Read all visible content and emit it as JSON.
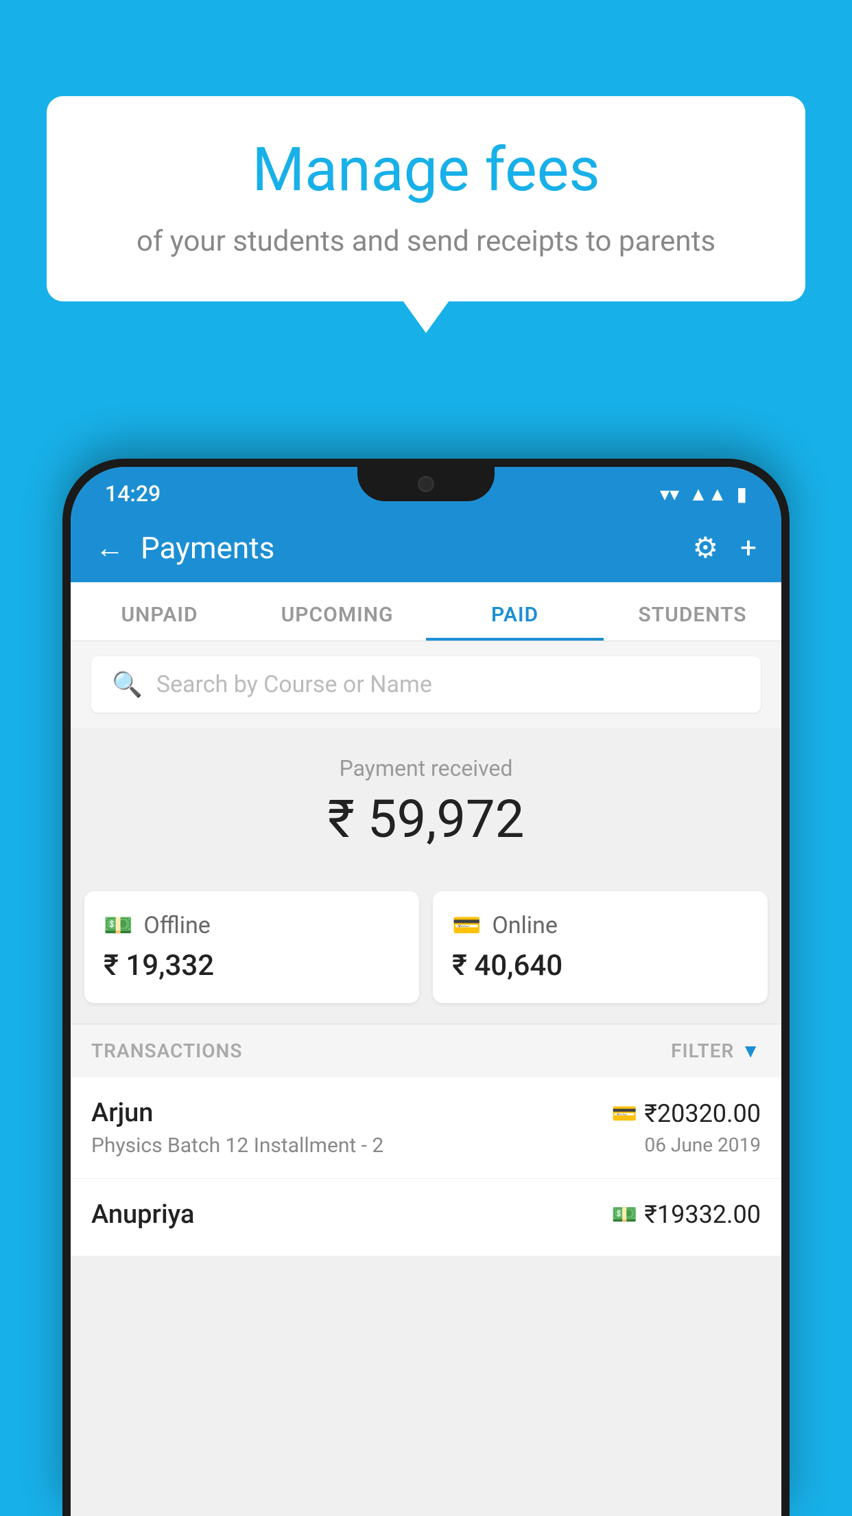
{
  "background_color": "#18b0e8",
  "speech_bubble": {
    "title": "Manage fees",
    "subtitle": "of your students and send receipts to parents"
  },
  "status_bar": {
    "time": "14:29",
    "icons": [
      "wifi",
      "signal",
      "battery"
    ]
  },
  "header": {
    "title": "Payments",
    "back_label": "←",
    "gear_label": "⚙",
    "plus_label": "+"
  },
  "tabs": [
    {
      "id": "unpaid",
      "label": "UNPAID",
      "active": false
    },
    {
      "id": "upcoming",
      "label": "UPCOMING",
      "active": false
    },
    {
      "id": "paid",
      "label": "PAID",
      "active": true
    },
    {
      "id": "students",
      "label": "STUDENTS",
      "active": false
    }
  ],
  "search": {
    "placeholder": "Search by Course or Name"
  },
  "payment_received": {
    "label": "Payment received",
    "amount": "₹ 59,972"
  },
  "payment_cards": [
    {
      "type": "Offline",
      "amount": "₹ 19,332",
      "icon": "cash"
    },
    {
      "type": "Online",
      "amount": "₹ 40,640",
      "icon": "card"
    }
  ],
  "transactions_section": {
    "label": "TRANSACTIONS",
    "filter_label": "FILTER"
  },
  "transactions": [
    {
      "name": "Arjun",
      "course": "Physics Batch 12 Installment - 2",
      "amount": "₹20320.00",
      "date": "06 June 2019",
      "payment_type": "online"
    },
    {
      "name": "Anupriya",
      "course": "",
      "amount": "₹19332.00",
      "date": "",
      "payment_type": "offline"
    }
  ]
}
